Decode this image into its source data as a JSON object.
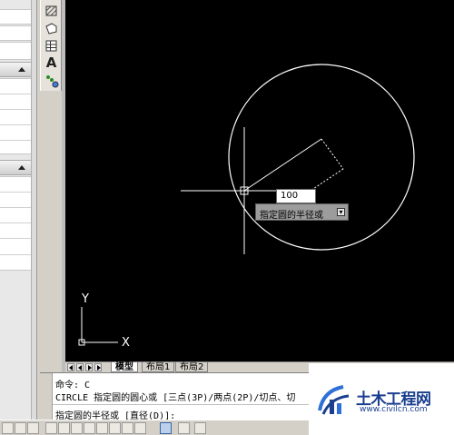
{
  "canvas": {
    "length_input_value": "100",
    "prompt_tip_text": "指定圆的半径或",
    "ucs_y_label": "Y",
    "ucs_x_label": "X"
  },
  "layout_tabs": [
    {
      "label": "模型",
      "active": true
    },
    {
      "label": "布局1",
      "active": false
    },
    {
      "label": "布局2",
      "active": false
    }
  ],
  "command": {
    "line1": "命令: C",
    "line2": "CIRCLE 指定圆的圆心或 [三点(3P)/两点(2P)/切点、切",
    "prompt": "指定圆的半径或 [直径(D)]:"
  },
  "toolbar": {
    "text_tool_glyph": "A"
  },
  "watermark": {
    "brand": "土木工程网",
    "url": "www.civilcn.com"
  },
  "colors": {
    "canvas_background": "#000000",
    "geometry": "#ffffff",
    "brand_blue": "#1a3f8f"
  }
}
